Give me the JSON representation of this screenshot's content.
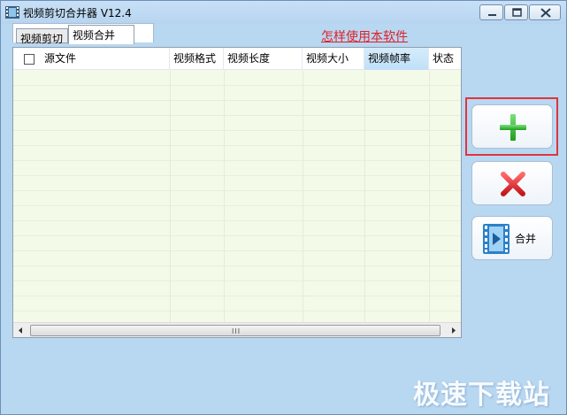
{
  "window": {
    "title": "视频剪切合并器 V12.4",
    "background_color": "#b8d7f1"
  },
  "tabs": [
    {
      "label": "视频剪切",
      "selected": false
    },
    {
      "label": "视频合并",
      "selected": true
    }
  ],
  "help_link": {
    "label": "怎样使用本软件",
    "color": "#e0202a"
  },
  "file_list": {
    "columns": [
      "源文件",
      "视频格式",
      "视频长度",
      "视频大小",
      "视频帧率",
      "状态"
    ],
    "active_column": "视频帧率",
    "rows": [],
    "scrollbar_grip": "III"
  },
  "buttons": {
    "add": {
      "icon": "plus-icon",
      "color": "#2db52d"
    },
    "delete": {
      "icon": "red-x-icon",
      "color": "#e0343c"
    },
    "merge": {
      "icon": "film-play-icon",
      "label": "合并"
    }
  },
  "watermark": "极速下载站"
}
